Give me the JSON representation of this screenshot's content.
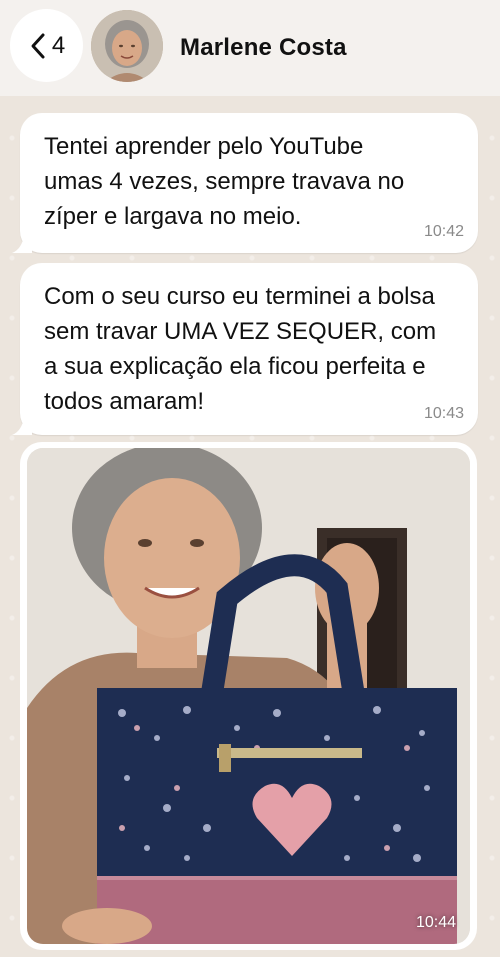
{
  "header": {
    "back_count": "4",
    "contact_name": "Marlene Costa"
  },
  "messages": [
    {
      "text": "Tentei aprender pelo YouTube\numas 4 vezes, sempre travava no\nzíper e largava no meio.",
      "time": "10:42"
    },
    {
      "text": "Com o seu curso eu terminei a bolsa\nsem travar UMA VEZ SEQUER, com\na sua explicação ela ficou perfeita e\ntodos amaram!",
      "time": "10:43"
    }
  ],
  "image_message": {
    "time": "10:44"
  },
  "colors": {
    "header_bg": "#f4f1ee",
    "chat_bg": "#ece5dd",
    "bubble_bg": "#ffffff",
    "time_color": "#8a8a8a",
    "bag_navy": "#1e2d52",
    "bag_pink": "#b06a7e",
    "heart_pink": "#e4a0a8"
  }
}
